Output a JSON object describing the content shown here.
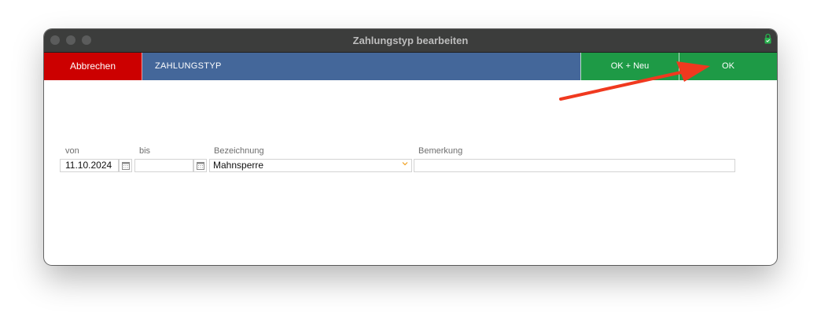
{
  "window": {
    "title": "Zahlungstyp bearbeiten"
  },
  "toolbar": {
    "cancel_label": "Abbrechen",
    "section_title": "ZAHLUNGSTYP",
    "ok_new_label": "OK + Neu",
    "ok_label": "OK"
  },
  "form": {
    "from": {
      "label": "von",
      "value": "11.10.2024"
    },
    "to": {
      "label": "bis",
      "value": ""
    },
    "designation": {
      "label": "Bezeichnung",
      "value": "Mahnsperre"
    },
    "remark": {
      "label": "Bemerkung",
      "value": ""
    }
  },
  "colors": {
    "cancel": "#cc0000",
    "section": "#44679a",
    "ok": "#1e9a46",
    "annotation_arrow": "#f0391f"
  }
}
